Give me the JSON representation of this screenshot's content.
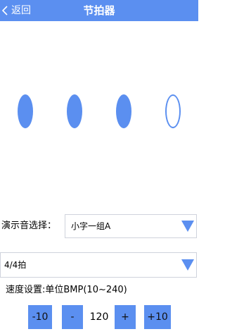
{
  "header": {
    "back_label": "返回",
    "title": "节拍器"
  },
  "beats": {
    "count": 4,
    "active_beats": [
      1,
      2,
      3
    ],
    "inactive_beats": [
      4
    ]
  },
  "sound": {
    "label": "演示音选择：",
    "selected": "小字一组A"
  },
  "time_signature": {
    "selected": "4/4拍"
  },
  "tempo": {
    "label": "速度设置:单位BMP(10~240)",
    "minus10_label": "-10",
    "minus_label": "-",
    "value": "120",
    "plus_label": "+",
    "plus10_label": "+10"
  },
  "colors": {
    "accent": "#5b8ff0",
    "header_text": "#ffffff"
  },
  "icons": {
    "back": "chevron-left-icon",
    "dropdown": "triangle-down-icon"
  }
}
